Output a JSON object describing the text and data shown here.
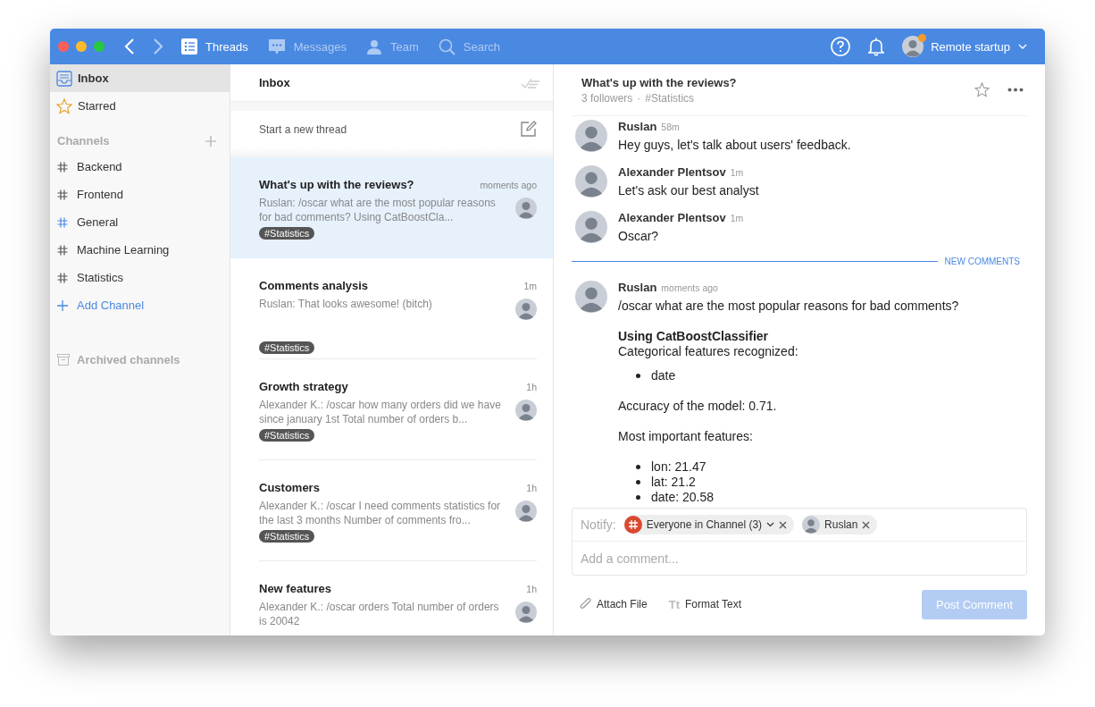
{
  "toolbar": {
    "nav": [
      {
        "label": "Threads",
        "selected": true
      },
      {
        "label": "Messages",
        "selected": false
      },
      {
        "label": "Team",
        "selected": false
      },
      {
        "label": "Search",
        "selected": false
      }
    ],
    "workspace": "Remote startup",
    "has_notification": true
  },
  "sidebar": {
    "items": [
      {
        "label": "Inbox",
        "selected": true
      },
      {
        "label": "Starred",
        "selected": false
      }
    ],
    "channels_title": "Channels",
    "channels": [
      {
        "label": "Backend",
        "active": false
      },
      {
        "label": "Frontend",
        "active": false
      },
      {
        "label": "General",
        "active": true
      },
      {
        "label": "Machine Learning",
        "active": false
      },
      {
        "label": "Statistics",
        "active": false
      }
    ],
    "add_channel": "Add Channel",
    "archived": "Archived channels"
  },
  "thread_list": {
    "title": "Inbox",
    "new_thread": "Start a new thread",
    "threads": [
      {
        "title": "What's up with the reviews?",
        "time": "moments ago",
        "preview": "Ruslan: /oscar what are the most popular reasons for bad comments?  Using CatBoostCla...",
        "tag": "#Statistics",
        "selected": true
      },
      {
        "title": "Comments analysis",
        "time": "1m",
        "preview": "Ruslan: That looks awesome! (bitch)",
        "tag": "#Statistics",
        "selected": false
      },
      {
        "title": "Growth strategy",
        "time": "1h",
        "preview": "Alexander K.: /oscar how many orders did we have since january 1st  Total number of orders b...",
        "tag": "#Statistics",
        "selected": false
      },
      {
        "title": "Customers",
        "time": "1h",
        "preview": "Alexander K.: /oscar I need comments statistics for the last 3 months  Number of comments fro...",
        "tag": "#Statistics",
        "selected": false
      },
      {
        "title": "New features",
        "time": "1h",
        "preview": "Alexander K.: /oscar orders  Total number of orders is 20042",
        "selected": false
      }
    ]
  },
  "conversation": {
    "title": "What's up with the reviews?",
    "followers": "3 followers",
    "separator": "·",
    "channel": "#Statistics",
    "starred": false,
    "items": [
      {
        "kind": "message",
        "author": "Ruslan",
        "time": "58m",
        "blocks": [
          {
            "kind": "text",
            "text": "Hey guys, let's talk about users' feedback."
          }
        ]
      },
      {
        "kind": "message",
        "author": "Alexander Plentsov",
        "time": "1m",
        "blocks": [
          {
            "kind": "text",
            "text": "Let's ask our best analyst"
          }
        ]
      },
      {
        "kind": "message",
        "author": "Alexander Plentsov",
        "time": "1m",
        "blocks": [
          {
            "kind": "text",
            "text": "Oscar?"
          }
        ]
      },
      {
        "kind": "divider",
        "label": "NEW COMMENTS"
      },
      {
        "kind": "message",
        "author": "Ruslan",
        "time": "moments ago",
        "blocks": [
          {
            "kind": "text",
            "text": "/oscar what are the most popular reasons for bad comments?"
          },
          {
            "kind": "heading",
            "text": "Using CatBoostClassifier"
          },
          {
            "kind": "line",
            "text": "Categorical features recognized:"
          },
          {
            "kind": "bullets",
            "items": [
              "date"
            ]
          },
          {
            "kind": "text",
            "text": "Accuracy of the model: 0.71."
          },
          {
            "kind": "text",
            "text": "Most important features:"
          },
          {
            "kind": "bullets",
            "items": [
              "lon: 21.47",
              "lat: 21.2",
              "date: 20.58"
            ]
          }
        ]
      }
    ]
  },
  "composer": {
    "notify_label": "Notify:",
    "chips": [
      {
        "kind": "channel",
        "label": "Everyone in Channel (3)",
        "dropdown": true
      },
      {
        "kind": "person",
        "label": "Ruslan",
        "dropdown": false
      }
    ],
    "placeholder": "Add a comment...",
    "attach": "Attach File",
    "format_icon": "Tt",
    "format": "Format Text",
    "post": "Post Comment",
    "post_disabled": true
  }
}
